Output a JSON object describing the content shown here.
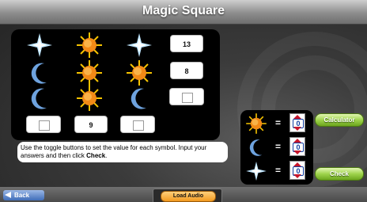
{
  "header": {
    "title": "Magic Square"
  },
  "grid": {
    "symbols": [
      [
        "star",
        "sun",
        "star"
      ],
      [
        "moon",
        "sun",
        "sun"
      ],
      [
        "moon",
        "sun",
        "moon"
      ]
    ],
    "row_sums": [
      "13",
      "8",
      ""
    ],
    "col_sums": [
      "",
      "9",
      ""
    ]
  },
  "instructions": {
    "text_before": "Use the toggle buttons to set the value for each symbol. Input your answers and then click ",
    "bold": "Check",
    "text_after": "."
  },
  "toggles": [
    {
      "symbol": "sun",
      "equals": "=",
      "value": "0"
    },
    {
      "symbol": "moon",
      "equals": "=",
      "value": "0"
    },
    {
      "symbol": "star",
      "equals": "=",
      "value": "0"
    }
  ],
  "buttons": {
    "calculator": "Calculator",
    "check": "Check"
  },
  "nav": {
    "back": "Back",
    "load_audio": "Load Audio"
  },
  "colors": {
    "accent_green": "#8cc63f",
    "toggle_red": "#c7162b",
    "toggle_blue": "#123fa0",
    "audio_orange": "#f29a1f"
  }
}
